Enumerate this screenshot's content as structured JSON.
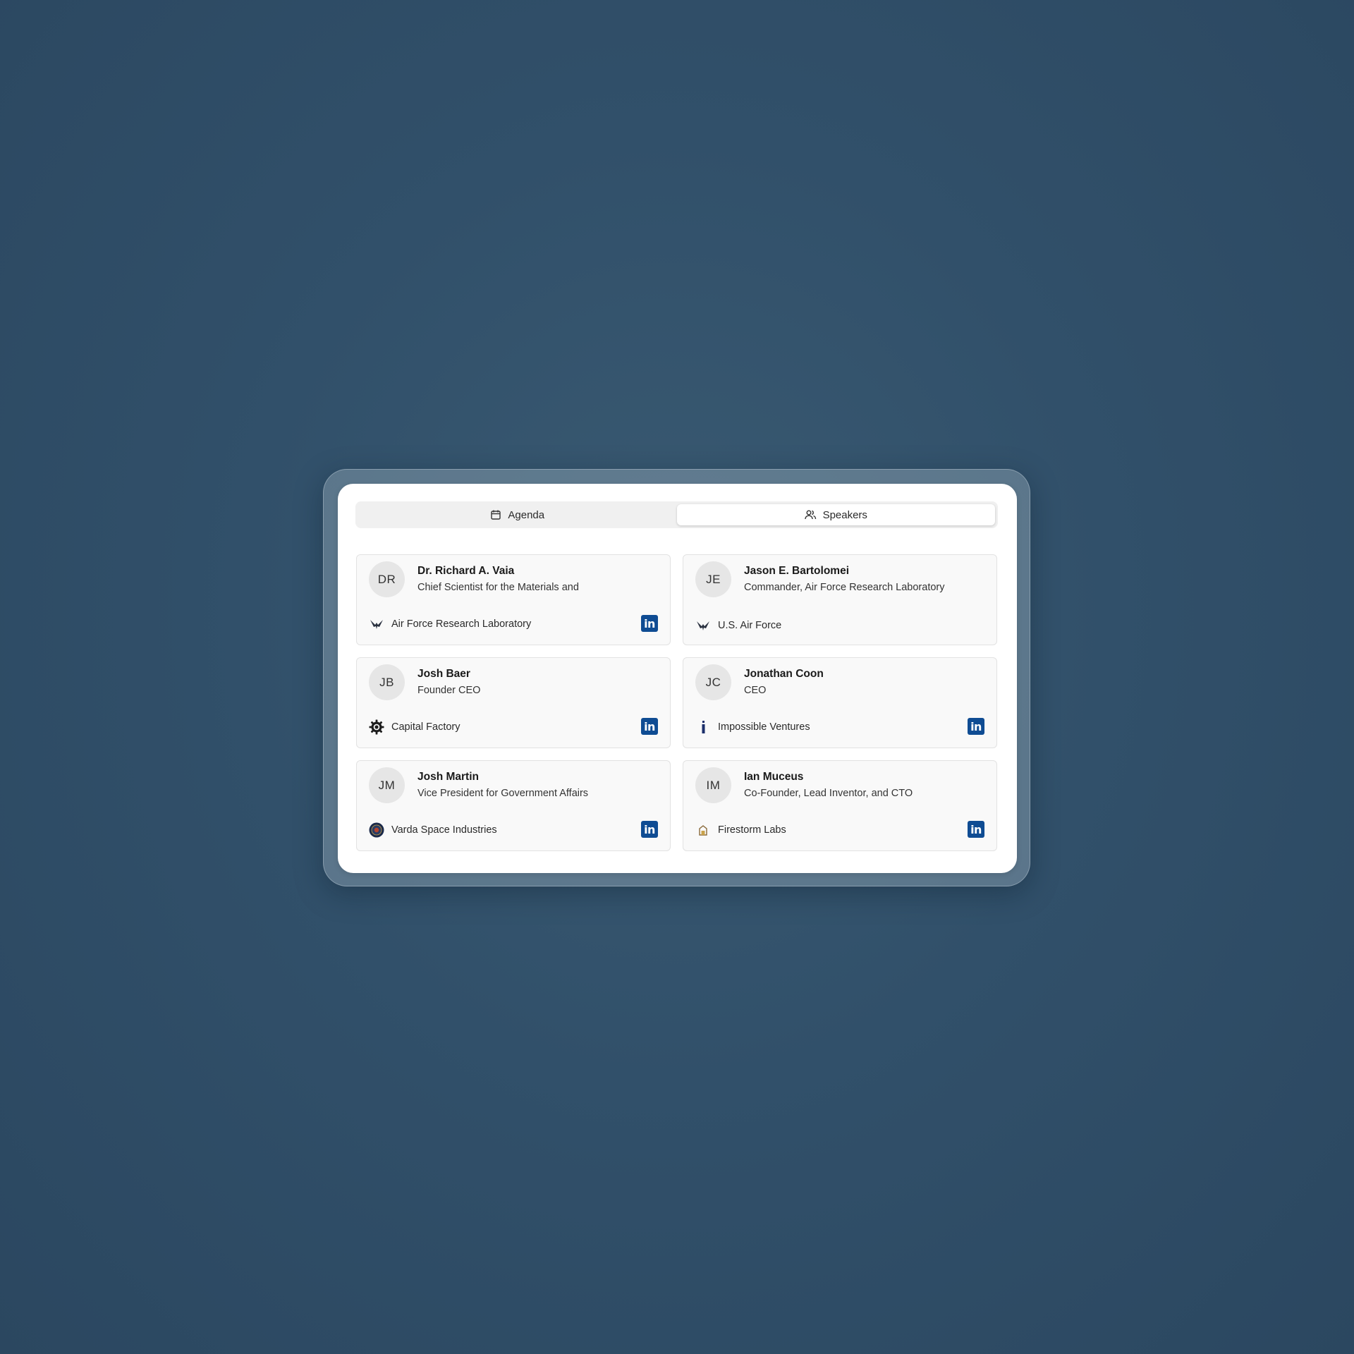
{
  "tabs": [
    {
      "label": "Agenda",
      "icon": "calendar-icon",
      "active": false
    },
    {
      "label": "Speakers",
      "icon": "users-icon",
      "active": true
    }
  ],
  "speakers": [
    {
      "initials": "DR",
      "name": "Dr. Richard A. Vaia",
      "title": "Chief Scientist for the Materials and",
      "org": "Air Force Research Laboratory",
      "org_logo": "air-force-wings-icon",
      "linkedin_label": "in",
      "has_linkedin": true
    },
    {
      "initials": "JE",
      "name": "Jason E. Bartolomei",
      "title": "Commander, Air Force Research Laboratory",
      "org": "U.S. Air Force",
      "org_logo": "air-force-wings-icon",
      "has_linkedin": false
    },
    {
      "initials": "JB",
      "name": "Josh Baer",
      "title": "Founder CEO",
      "org": "Capital Factory",
      "org_logo": "gear-logo-icon",
      "linkedin_label": "in",
      "has_linkedin": true
    },
    {
      "initials": "JC",
      "name": "Jonathan Coon",
      "title": "CEO",
      "org": "Impossible Ventures",
      "org_logo": "letter-i-logo-icon",
      "linkedin_label": "in",
      "has_linkedin": true
    },
    {
      "initials": "JM",
      "name": "Josh Martin",
      "title": "Vice President for Government Affairs",
      "org": "Varda Space Industries",
      "org_logo": "varda-seal-icon",
      "linkedin_label": "in",
      "has_linkedin": true
    },
    {
      "initials": "IM",
      "name": "Ian Muceus",
      "title": "Co-Founder, Lead Inventor, and CTO",
      "org": "Firestorm Labs",
      "org_logo": "firestorm-logo-icon",
      "linkedin_label": "in",
      "has_linkedin": true
    }
  ],
  "colors": {
    "linkedin": "#0f4c93",
    "background": "#31506a",
    "card": "#f9f9f9"
  }
}
